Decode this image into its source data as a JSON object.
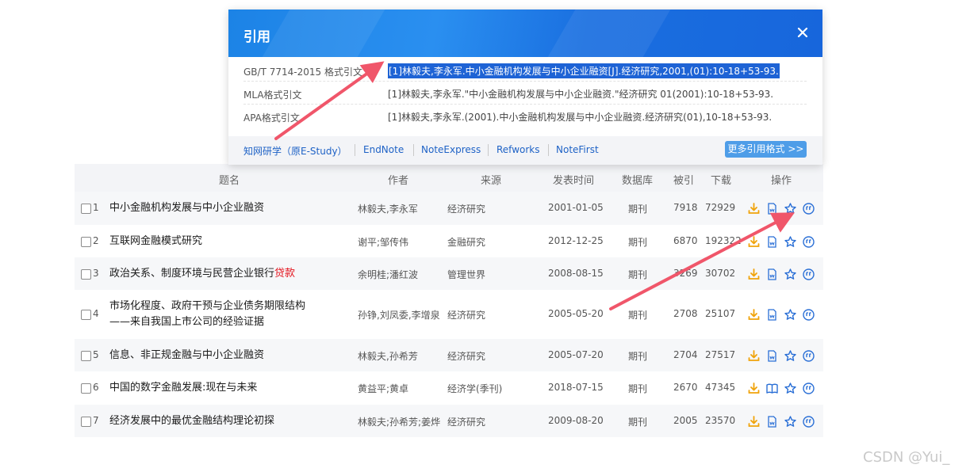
{
  "dialog": {
    "title": "引用",
    "formats": [
      {
        "name": "GB/T 7714-2015 格式引文",
        "citation": "[1]林毅夫,李永军.中小金融机构发展与中小企业融资[J].经济研究,2001,(01):10-18+53-93."
      },
      {
        "name": "MLA格式引文",
        "citation": "[1]林毅夫,李永军.\"中小金融机构发展与中小企业融资.\"经济研究 01(2001):10-18+53-93."
      },
      {
        "name": "APA格式引文",
        "citation": "[1]林毅夫,李永军.(2001).中小金融机构发展与中小企业融资.经济研究(01),10-18+53-93."
      }
    ],
    "exports": [
      "知网研学（原E-Study）",
      "EndNote",
      "NoteExpress",
      "Refworks",
      "NoteFirst"
    ],
    "more_button": "更多引用格式 >>",
    "accent_color": "#1a73e8"
  },
  "table": {
    "headers": {
      "title": "题名",
      "author": "作者",
      "source": "来源",
      "date": "发表时间",
      "db": "数据库",
      "cited": "被引",
      "downloads": "下载",
      "ops": "操作"
    },
    "rows": [
      {
        "num": "1",
        "title": "中小金融机构发展与中小企业融资",
        "author": "林毅夫,李永军",
        "source": "经济研究",
        "date": "2001-01-05",
        "db": "期刊",
        "cited": "7918",
        "downloads": "72929"
      },
      {
        "num": "2",
        "title": "互联网金融模式研究",
        "author": "谢平;邹传伟",
        "source": "金融研究",
        "date": "2012-12-25",
        "db": "期刊",
        "cited": "6870",
        "downloads": "192322"
      },
      {
        "num": "3",
        "title": "政治关系、制度环境与民营企业银行",
        "title_hl": "贷款",
        "author": "余明桂;潘红波",
        "source": "管理世界",
        "date": "2008-08-15",
        "db": "期刊",
        "cited": "3269",
        "downloads": "30702"
      },
      {
        "num": "4",
        "title": "市场化程度、政府干预与企业债务期限结构",
        "title2": "——来自我国上市公司的经验证据",
        "author": "孙铮,刘凤委,李增泉",
        "source": "经济研究",
        "date": "2005-05-20",
        "db": "期刊",
        "cited": "2708",
        "downloads": "25107"
      },
      {
        "num": "5",
        "title": "信息、非正规金融与中小企业融资",
        "author": "林毅夫,孙希芳",
        "source": "经济研究",
        "date": "2005-07-20",
        "db": "期刊",
        "cited": "2704",
        "downloads": "27517"
      },
      {
        "num": "6",
        "title": "中国的数字金融发展:现在与未来",
        "author": "黄益平;黄卓",
        "source": "经济学(季刊)",
        "date": "2018-07-15",
        "db": "期刊",
        "cited": "2670",
        "downloads": "47345"
      },
      {
        "num": "7",
        "title": "经济发展中的最优金融结构理论初探",
        "author": "林毅夫;孙希芳;姜烨",
        "source": "经济研究",
        "date": "2009-08-20",
        "db": "期刊",
        "cited": "2005",
        "downloads": "23570"
      }
    ]
  },
  "icons": {
    "download": "download-icon",
    "html_read": "html-read-icon",
    "book_read": "book-read-icon",
    "favorite": "star-icon",
    "cite": "quote-icon",
    "close": "close-icon"
  },
  "colors": {
    "link": "#1e62c6",
    "download_icon": "#f0a30a",
    "op_icon": "#2a6fd6",
    "highlight_keyword": "#e4121c",
    "selection": "#1e63d5",
    "arrow": "#f0566a"
  },
  "watermark": "CSDN @Yui_"
}
